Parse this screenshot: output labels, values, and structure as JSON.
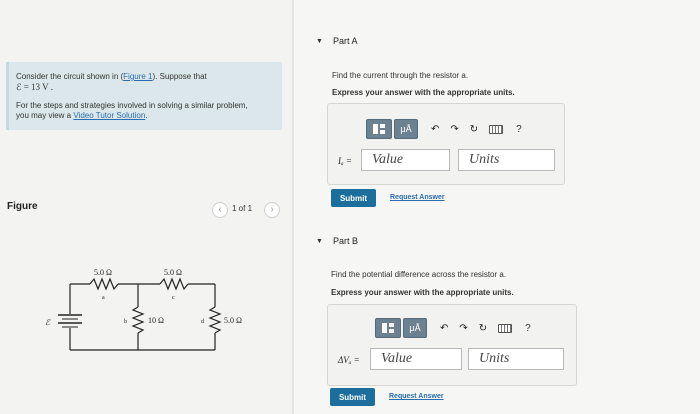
{
  "problem": {
    "line1_pre": "Consider the circuit shown in (",
    "line1_link": "Figure 1",
    "line1_post": "). Suppose that",
    "line2": "ℰ = 13  V .",
    "line3": "For the steps and strategies involved in solving a similar problem,",
    "line4_pre": "you may view a ",
    "line4_link": "Video Tutor Solution",
    "line4_post": "."
  },
  "figure": {
    "title": "Figure",
    "pager_prev": "‹",
    "pager_text": "1 of 1",
    "pager_next": "›"
  },
  "circuit": {
    "emf_label": "ℰ",
    "r_top_left": "5.0 Ω",
    "r_top_right": "5.0 Ω",
    "r_middle": "10 Ω",
    "r_right": "5.0 Ω",
    "node_a": "a",
    "node_b": "b",
    "node_c": "c",
    "node_d": "d"
  },
  "toolbar": {
    "matrix_icon": "template-icon",
    "units_label": "μÅ",
    "undo_icon": "undo-icon",
    "redo_icon": "redo-icon",
    "reset_icon": "reset-icon",
    "keyboard_icon": "keyboard-icon",
    "help_label": "?"
  },
  "partA": {
    "caret": "▼",
    "title": "Part A",
    "question": "Find the current through the resistor a.",
    "instruction": "Express your answer with the appropriate units.",
    "var_label": "Iₐ =",
    "value_placeholder": "Value",
    "units_placeholder": "Units",
    "submit": "Submit",
    "request": "Request Answer"
  },
  "partB": {
    "caret": "▼",
    "title": "Part B",
    "question": "Find the potential difference across the resistor a.",
    "instruction": "Express your answer with the appropriate units.",
    "var_label": "ΔVₐ =",
    "value_placeholder": "Value",
    "units_placeholder": "Units",
    "submit": "Submit",
    "request": "Request Answer"
  },
  "colors": {
    "submit_bg": "#1c6e9c",
    "link": "#2a6cb1",
    "intro_bg": "#dbe7ea",
    "toolbar_btn": "#6d8291"
  }
}
